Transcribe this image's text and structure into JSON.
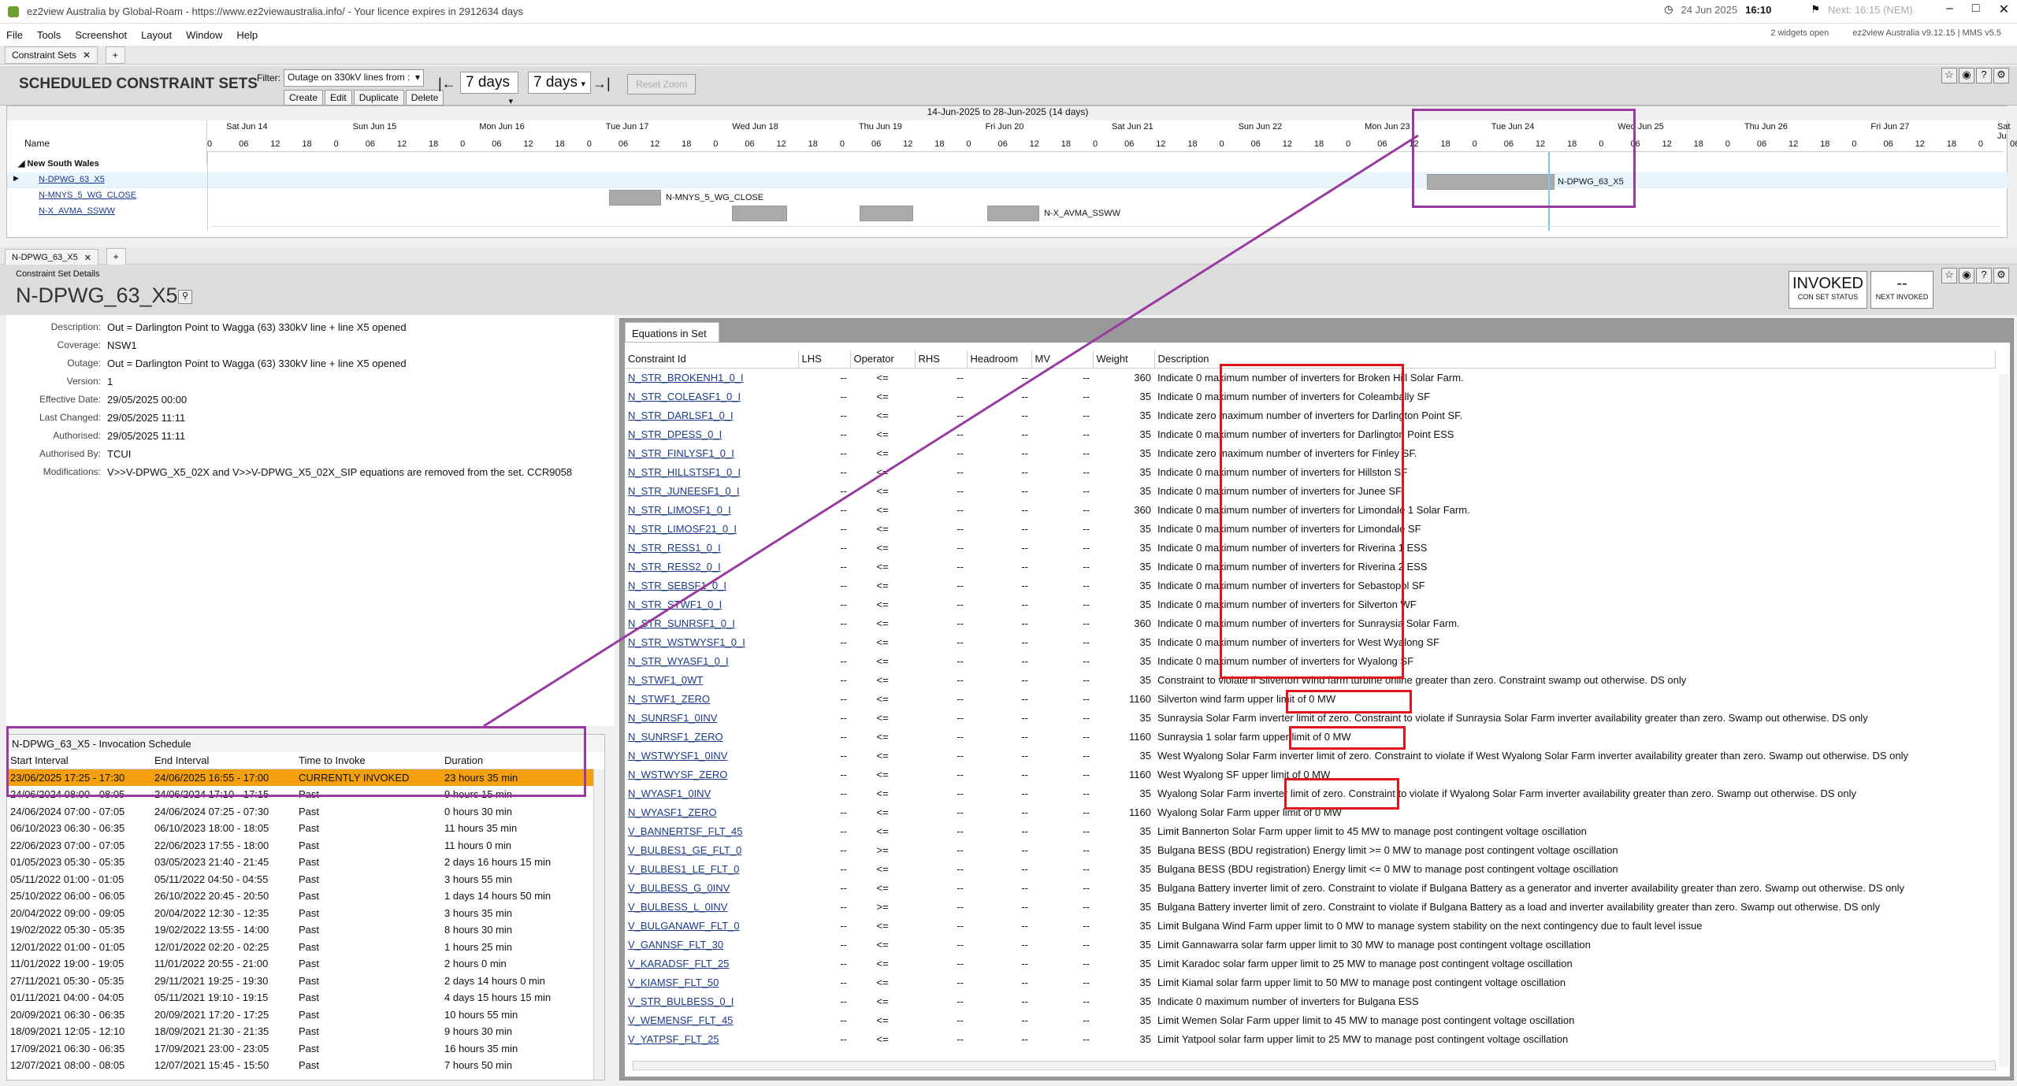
{
  "window": {
    "title": "ez2view Australia by Global-Roam - https://www.ez2viewaustralia.info/ - Your licence expires in 2912634 days",
    "clock_date": "24 Jun 2025",
    "clock_time": "16:10",
    "next": "Next: 16:15 (NEM)",
    "widgets_open": "2 widgets open",
    "version": "ez2view Australia v9.12.15 | MMS v5.5"
  },
  "menu": [
    "File",
    "Tools",
    "Screenshot",
    "Layout",
    "Window",
    "Help"
  ],
  "tabs": {
    "top": "Constraint Sets",
    "bottom": "N-DPWG_63_X5"
  },
  "toolbar": {
    "title": "SCHEDULED CONSTRAINT SETS",
    "filter_label": "Filter:",
    "filter_value": "Outage on 330kV lines from :",
    "create": "Create",
    "edit": "Edit",
    "duplicate": "Duplicate",
    "delete": "Delete",
    "range1": "7 days",
    "range2": "7 days",
    "reset_zoom": "Reset Zoom"
  },
  "gantt": {
    "range": "14-Jun-2025 to 28-Jun-2025 (14 days)",
    "name_header": "Name",
    "days": [
      "Sat Jun 14",
      "Sun Jun 15",
      "Mon Jun 16",
      "Tue Jun 17",
      "Wed Jun 18",
      "Thu Jun 19",
      "Fri Jun 20",
      "Sat Jun 21",
      "Sun Jun 22",
      "Mon Jun 23",
      "Tue Jun 24",
      "Wed Jun 25",
      "Thu Jun 26",
      "Fri Jun 27",
      "Sat Ju"
    ],
    "hours": [
      "0",
      "06",
      "12",
      "18"
    ],
    "group": "New South Wales",
    "rows": [
      "N-DPWG_63_X5",
      "N-MNYS_5_WG_CLOSE",
      "N-X_AVMA_SSWW"
    ],
    "bar_labels": [
      "N-DPWG_63_X5",
      "N-MNYS_5_WG_CLOSE",
      "N-X_AVMA_SSWW"
    ]
  },
  "details": {
    "section": "Constraint Set Details",
    "name": "N-DPWG_63_X5",
    "status": "INVOKED",
    "status_sub": "CON SET STATUS",
    "next": "--",
    "next_sub": "NEXT INVOKED",
    "fields": [
      [
        "Description:",
        "Out = Darlington Point to Wagga (63) 330kV line + line X5 opened"
      ],
      [
        "Coverage:",
        "NSW1"
      ],
      [
        "Outage:",
        "Out = Darlington Point to Wagga (63) 330kV line + line X5 opened"
      ],
      [
        "Version:",
        "1"
      ],
      [
        "Effective Date:",
        "29/05/2025 00:00"
      ],
      [
        "Last Changed:",
        "29/05/2025 11:11"
      ],
      [
        "Authorised:",
        "29/05/2025 11:11"
      ],
      [
        "Authorised By:",
        "TCUI"
      ],
      [
        "Modifications:",
        "V>>V-DPWG_X5_02X and V>>V-DPWG_X5_02X_SIP equations are removed from the set. CCR9058"
      ]
    ]
  },
  "invocation": {
    "title": "N-DPWG_63_X5 - Invocation Schedule",
    "headers": [
      "Start Interval",
      "End Interval",
      "Time to Invoke",
      "Duration"
    ],
    "rows": [
      [
        "23/06/2025 17:25 - 17:30",
        "24/06/2025 16:55 - 17:00",
        "CURRENTLY INVOKED",
        "23 hours 35 min"
      ],
      [
        "24/06/2024 08:00 - 08:05",
        "24/06/2024 17:10 - 17:15",
        "Past",
        "9 hours 15 min"
      ],
      [
        "24/06/2024 07:00 - 07:05",
        "24/06/2024 07:25 - 07:30",
        "Past",
        "0 hours 30 min"
      ],
      [
        "06/10/2023 06:30 - 06:35",
        "06/10/2023 18:00 - 18:05",
        "Past",
        "11 hours 35 min"
      ],
      [
        "22/06/2023 07:00 - 07:05",
        "22/06/2023 17:55 - 18:00",
        "Past",
        "11 hours 0 min"
      ],
      [
        "01/05/2023 05:30 - 05:35",
        "03/05/2023 21:40 - 21:45",
        "Past",
        "2 days 16 hours 15 min"
      ],
      [
        "05/11/2022 01:00 - 01:05",
        "05/11/2022 04:50 - 04:55",
        "Past",
        "3 hours 55 min"
      ],
      [
        "25/10/2022 06:00 - 06:05",
        "26/10/2022 20:45 - 20:50",
        "Past",
        "1 days 14 hours 50 min"
      ],
      [
        "20/04/2022 09:00 - 09:05",
        "20/04/2022 12:30 - 12:35",
        "Past",
        "3 hours 35 min"
      ],
      [
        "19/02/2022 05:30 - 05:35",
        "19/02/2022 13:55 - 14:00",
        "Past",
        "8 hours 30 min"
      ],
      [
        "12/01/2022 01:00 - 01:05",
        "12/01/2022 02:20 - 02:25",
        "Past",
        "1 hours 25 min"
      ],
      [
        "11/01/2022 19:00 - 19:05",
        "11/01/2022 20:55 - 21:00",
        "Past",
        "2 hours 0 min"
      ],
      [
        "27/11/2021 05:30 - 05:35",
        "29/11/2021 19:25 - 19:30",
        "Past",
        "2 days 14 hours 0 min"
      ],
      [
        "01/11/2021 04:00 - 04:05",
        "05/11/2021 19:10 - 19:15",
        "Past",
        "4 days 15 hours 15 min"
      ],
      [
        "20/09/2021 06:30 - 06:35",
        "20/09/2021 17:20 - 17:25",
        "Past",
        "10 hours 55 min"
      ],
      [
        "18/09/2021 12:05 - 12:10",
        "18/09/2021 21:30 - 21:35",
        "Past",
        "9 hours 30 min"
      ],
      [
        "17/09/2021 06:30 - 06:35",
        "17/09/2021 23:00 - 23:05",
        "Past",
        "16 hours 35 min"
      ],
      [
        "12/07/2021 08:00 - 08:05",
        "12/07/2021 15:45 - 15:50",
        "Past",
        "7 hours 50 min"
      ]
    ]
  },
  "equations": {
    "tab": "Equations in Set",
    "headers": [
      "Constraint Id",
      "LHS",
      "Operator",
      "RHS",
      "Headroom",
      "MV",
      "Weight",
      "Description"
    ],
    "rows": [
      [
        "N_STR_BROKENH1_0_I",
        "--",
        "<=",
        "--",
        "--",
        "--",
        "360",
        "Indicate 0 maximum number of inverters for Broken Hill Solar Farm."
      ],
      [
        "N_STR_COLEASF1_0_I",
        "--",
        "<=",
        "--",
        "--",
        "--",
        "35",
        "Indicate 0 maximum number of inverters for Coleambally SF"
      ],
      [
        "N_STR_DARLSF1_0_I",
        "--",
        "<=",
        "--",
        "--",
        "--",
        "35",
        "Indicate zero maximum number of inverters for Darlington Point SF."
      ],
      [
        "N_STR_DPESS_0_I",
        "--",
        "<=",
        "--",
        "--",
        "--",
        "35",
        "Indicate 0 maximum number of inverters for Darlington Point ESS"
      ],
      [
        "N_STR_FINLYSF1_0_I",
        "--",
        "<=",
        "--",
        "--",
        "--",
        "35",
        "Indicate zero maximum number of inverters for Finley SF."
      ],
      [
        "N_STR_HILLSTSF1_0_I",
        "--",
        "<=",
        "--",
        "--",
        "--",
        "35",
        "Indicate 0 maximum number of inverters for Hillston SF"
      ],
      [
        "N_STR_JUNEESF1_0_I",
        "--",
        "<=",
        "--",
        "--",
        "--",
        "35",
        "Indicate 0 maximum number of inverters for Junee SF"
      ],
      [
        "N_STR_LIMOSF1_0_I",
        "--",
        "<=",
        "--",
        "--",
        "--",
        "360",
        "Indicate 0 maximum number of inverters for Limondale 1 Solar Farm."
      ],
      [
        "N_STR_LIMOSF21_0_I",
        "--",
        "<=",
        "--",
        "--",
        "--",
        "35",
        "Indicate 0 maximum number of inverters for Limondale SF"
      ],
      [
        "N_STR_RESS1_0_I",
        "--",
        "<=",
        "--",
        "--",
        "--",
        "35",
        "Indicate 0 maximum number of inverters for Riverina 1 ESS"
      ],
      [
        "N_STR_RESS2_0_I",
        "--",
        "<=",
        "--",
        "--",
        "--",
        "35",
        "Indicate 0 maximum number of inverters for Riverina 2 ESS"
      ],
      [
        "N_STR_SEBSF1_0_I",
        "--",
        "<=",
        "--",
        "--",
        "--",
        "35",
        "Indicate 0 maximum number of inverters for Sebastopol SF"
      ],
      [
        "N_STR_STWF1_0_I",
        "--",
        "<=",
        "--",
        "--",
        "--",
        "35",
        "Indicate 0 maximum number of inverters for Silverton WF"
      ],
      [
        "N_STR_SUNRSF1_0_I",
        "--",
        "<=",
        "--",
        "--",
        "--",
        "360",
        "Indicate 0 maximum number of inverters for Sunraysia Solar Farm."
      ],
      [
        "N_STR_WSTWYSF1_0_I",
        "--",
        "<=",
        "--",
        "--",
        "--",
        "35",
        "Indicate 0 maximum number of inverters for West Wyalong SF"
      ],
      [
        "N_STR_WYASF1_0_I",
        "--",
        "<=",
        "--",
        "--",
        "--",
        "35",
        "Indicate 0 maximum number of inverters for Wyalong SF"
      ],
      [
        "N_STWF1_0WT",
        "--",
        "<=",
        "--",
        "--",
        "--",
        "35",
        "Constraint to violate if Silverton Wind farm turbine online greater than zero. Constraint swamp out otherwise. DS only"
      ],
      [
        "N_STWF1_ZERO",
        "--",
        "<=",
        "--",
        "--",
        "--",
        "1160",
        "Silverton wind farm upper limit of 0 MW"
      ],
      [
        "N_SUNRSF1_0INV",
        "--",
        "<=",
        "--",
        "--",
        "--",
        "35",
        "Sunraysia Solar Farm inverter limit of zero. Constraint to violate if Sunraysia Solar Farm inverter availability greater than zero. Swamp out otherwise. DS only"
      ],
      [
        "N_SUNRSF1_ZERO",
        "--",
        "<=",
        "--",
        "--",
        "--",
        "1160",
        "Sunraysia 1 solar farm upper limit of 0 MW"
      ],
      [
        "N_WSTWYSF1_0INV",
        "--",
        "<=",
        "--",
        "--",
        "--",
        "35",
        "West Wyalong Solar Farm inverter limit of zero. Constraint to violate if West Wyalong Solar Farm inverter availability greater than zero. Swamp out otherwise. DS only"
      ],
      [
        "N_WSTWYSF_ZERO",
        "--",
        "<=",
        "--",
        "--",
        "--",
        "1160",
        "West Wyalong SF upper limit of 0 MW"
      ],
      [
        "N_WYASF1_0INV",
        "--",
        "<=",
        "--",
        "--",
        "--",
        "35",
        "Wyalong Solar Farm inverter limit of zero. Constraint to violate if Wyalong Solar Farm inverter availability greater than zero. Swamp out otherwise. DS only"
      ],
      [
        "N_WYASF1_ZERO",
        "--",
        "<=",
        "--",
        "--",
        "--",
        "1160",
        "Wyalong Solar Farm upper limit of 0 MW"
      ],
      [
        "V_BANNERTSF_FLT_45",
        "--",
        "<=",
        "--",
        "--",
        "--",
        "35",
        "Limit Bannerton Solar Farm upper limit to 45 MW to manage post contingent voltage oscillation"
      ],
      [
        "V_BULBES1_GE_FLT_0",
        "--",
        ">=",
        "--",
        "--",
        "--",
        "35",
        "Bulgana BESS (BDU registration) Energy limit >= 0 MW to manage post contingent voltage oscillation"
      ],
      [
        "V_BULBES1_LE_FLT_0",
        "--",
        "<=",
        "--",
        "--",
        "--",
        "35",
        "Bulgana BESS (BDU registration) Energy limit <= 0 MW to manage post contingent voltage oscillation"
      ],
      [
        "V_BULBESS_G_0INV",
        "--",
        "<=",
        "--",
        "--",
        "--",
        "35",
        "Bulgana Battery inverter limit of zero. Constraint to violate if Bulgana Battery as a generator and inverter availability greater than zero. Swamp out otherwise. DS only"
      ],
      [
        "V_BULBESS_L_0INV",
        "--",
        ">=",
        "--",
        "--",
        "--",
        "35",
        "Bulgana Battery inverter limit of zero. Constraint to violate if Bulgana Battery as a load and inverter availability greater than zero. Swamp out otherwise. DS only"
      ],
      [
        "V_BULGANAWF_FLT_0",
        "--",
        "<=",
        "--",
        "--",
        "--",
        "35",
        "Limit Bulgana Wind Farm upper limit to 0 MW to manage system stability on the next contingency due to fault level issue"
      ],
      [
        "V_GANNSF_FLT_30",
        "--",
        "<=",
        "--",
        "--",
        "--",
        "35",
        "Limit Gannawarra solar farm upper limit to 30 MW to manage post contingent voltage oscillation"
      ],
      [
        "V_KARADSF_FLT_25",
        "--",
        "<=",
        "--",
        "--",
        "--",
        "35",
        "Limit Karadoc solar farm upper limit to 25 MW to manage post contingent voltage oscillation"
      ],
      [
        "V_KIAMSF_FLT_50",
        "--",
        "<=",
        "--",
        "--",
        "--",
        "35",
        "Limit Kiamal solar farm upper limit to 50 MW to manage post contingent voltage oscillation"
      ],
      [
        "V_STR_BULBESS_0_I",
        "--",
        "<=",
        "--",
        "--",
        "--",
        "35",
        "Indicate 0 maximum number of inverters for Bulgana ESS"
      ],
      [
        "V_WEMENSF_FLT_45",
        "--",
        "<=",
        "--",
        "--",
        "--",
        "35",
        "Limit Wemen Solar Farm upper limit to 45 MW to manage post contingent voltage oscillation"
      ],
      [
        "V_YATPSF_FLT_25",
        "--",
        "<=",
        "--",
        "--",
        "--",
        "35",
        "Limit Yatpool solar farm upper limit to 25 MW to manage post contingent voltage oscillation"
      ]
    ]
  },
  "colors": {
    "accent_purple": "#9a3aa0",
    "highlight_red": "#e0141c",
    "invoked_row": "#f5a10f"
  }
}
